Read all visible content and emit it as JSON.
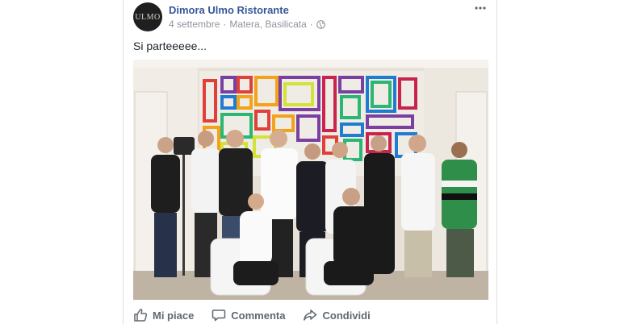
{
  "post": {
    "page_name": "Dimora Ulmo Ristorante",
    "avatar_text": "ULMO",
    "date": "4 settembre",
    "separator": "·",
    "location": "Matera, Basilicata",
    "separator2": "·",
    "text": "Si parteeeee..."
  },
  "photo": {
    "subject": "group-photo-staff"
  },
  "actions": {
    "like_label": "Mi piace",
    "comment_label": "Commenta",
    "share_label": "Condividi"
  },
  "colors": {
    "link": "#365899",
    "meta": "#90949c",
    "action": "#606770"
  }
}
